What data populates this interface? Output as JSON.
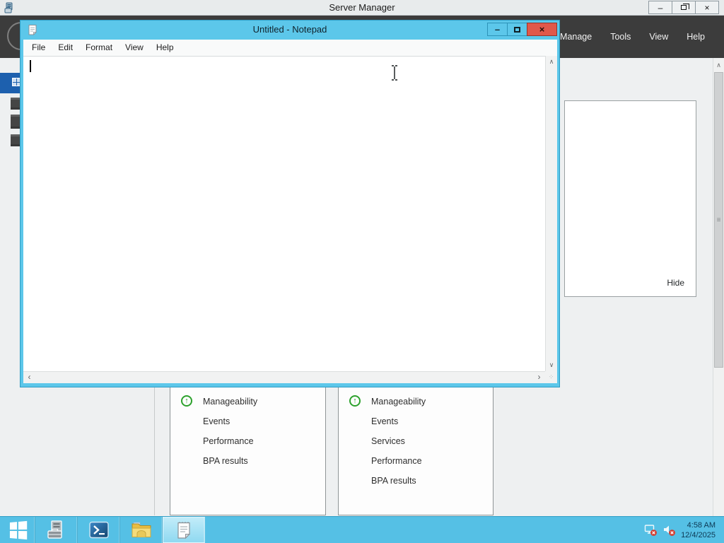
{
  "colors": {
    "chrome_cyan": "#5cc7ea",
    "taskbar_cyan": "#55c0e5",
    "close_red": "#e0584a",
    "header_dark": "#3c3c3c",
    "selected_nav_blue": "#1d60ae",
    "status_green": "#2ca12c",
    "body_gray": "#eef0f1"
  },
  "icons": {
    "minimize": "–",
    "close": "×",
    "scroll_up": "∧",
    "scroll_down": "∨",
    "scroll_left": "‹",
    "scroll_right": "›",
    "grip": "≡",
    "status_up": "↑",
    "resize_grip": "⁘"
  },
  "server_manager": {
    "title": "Server Manager",
    "menu": [
      "Manage",
      "Tools",
      "View",
      "Help"
    ],
    "welcome_panel": {
      "hide_label": "Hide"
    },
    "tiles": [
      {
        "rows": [
          {
            "label": "Manageability"
          },
          {
            "label": "Events"
          },
          {
            "label": "Performance"
          },
          {
            "label": "BPA results"
          }
        ]
      },
      {
        "rows": [
          {
            "label": "Manageability"
          },
          {
            "label": "Events"
          },
          {
            "label": "Services"
          },
          {
            "label": "Performance"
          },
          {
            "label": "BPA results"
          }
        ]
      }
    ]
  },
  "notepad": {
    "title": "Untitled - Notepad",
    "menu": [
      "File",
      "Edit",
      "Format",
      "View",
      "Help"
    ],
    "editor_content": ""
  },
  "taskbar": {
    "tray": {
      "time": "4:58 AM",
      "date": "12/4/2025"
    }
  }
}
